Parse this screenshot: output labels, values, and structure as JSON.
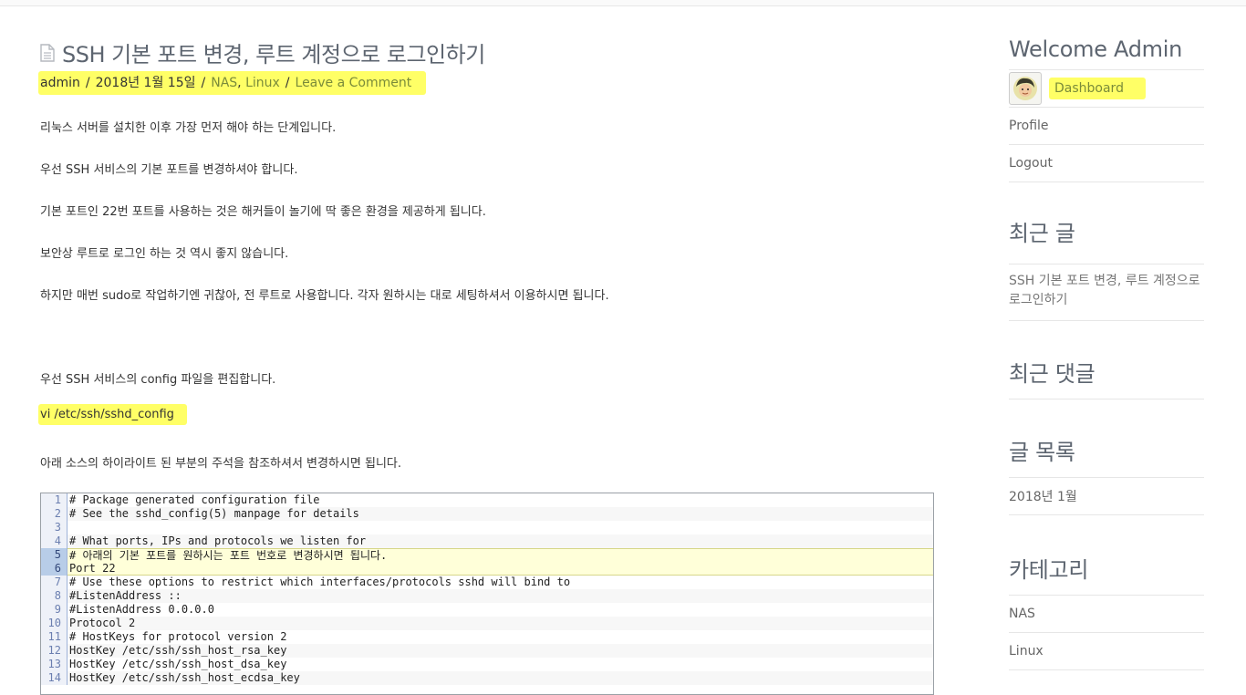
{
  "post": {
    "title": "SSH 기본 포트 변경, 루트 계정으로 로그인하기",
    "meta": {
      "author": "admin",
      "date": "2018년 1월 15일",
      "cat1": "NAS",
      "cat_sep": ",",
      "cat2": "Linux",
      "comment": "Leave a Comment"
    },
    "paragraphs": [
      "리눅스 서버를 설치한 이후 가장 먼저 해야 하는 단계입니다.",
      "우선 SSH 서비스의 기본 포트를 변경하셔야 합니다.",
      "기본 포트인 22번 포트를 사용하는 것은 해커들이 놀기에 딱 좋은 환경을 제공하게 됩니다.",
      "보안상 루트로 로그인 하는 것 역시 좋지 않습니다.",
      "하지만 매번 sudo로 작업하기엔 귀찮아,  전 루트로 사용합니다.  각자 원하시는 대로 세팅하셔서 이용하시면 됩니다.",
      "우선 SSH 서비스의 config 파일을 편집합니다.",
      "vi /etc/ssh/sshd_config",
      "아래 소스의 하이라이트 된 부분의 주석을 참조하셔서 변경하시면 됩니다."
    ],
    "code_lines": [
      {
        "num": "1",
        "text": "# Package generated configuration file"
      },
      {
        "num": "2",
        "text": "# See the sshd_config(5) manpage for details"
      },
      {
        "num": "3",
        "text": ""
      },
      {
        "num": "4",
        "text": "# What ports, IPs and protocols we listen for"
      },
      {
        "num": "5",
        "text": "# 아래의 기본 포트를 원하시는 포트 번호로 변경하시면 됩니다."
      },
      {
        "num": "6",
        "text": "Port 22"
      },
      {
        "num": "7",
        "text": "# Use these options to restrict which interfaces/protocols sshd will bind to"
      },
      {
        "num": "8",
        "text": "#ListenAddress ::"
      },
      {
        "num": "9",
        "text": "#ListenAddress 0.0.0.0"
      },
      {
        "num": "10",
        "text": "Protocol 2"
      },
      {
        "num": "11",
        "text": "# HostKeys for protocol version 2"
      },
      {
        "num": "12",
        "text": "HostKey /etc/ssh/ssh_host_rsa_key"
      },
      {
        "num": "13",
        "text": "HostKey /etc/ssh/ssh_host_dsa_key"
      },
      {
        "num": "14",
        "text": "HostKey /etc/ssh/ssh_host_ecdsa_key"
      }
    ]
  },
  "sidebar": {
    "welcome_title": "Welcome Admin",
    "dashboard": "Dashboard",
    "profile": "Profile",
    "logout": "Logout",
    "recent_posts_title": "최근 글",
    "recent_post_1": "SSH 기본 포트 변경, 루트 계정으로 로그인하기",
    "recent_comments_title": "최근 댓글",
    "archives_title": "글 목록",
    "archive_1": "2018년 1월",
    "categories_title": "카테고리",
    "cat_nas": "NAS",
    "cat_linux": "Linux"
  },
  "colors": {
    "highlight": "#ffff66",
    "link": "#7a8b3a",
    "heading": "#5d6570"
  }
}
